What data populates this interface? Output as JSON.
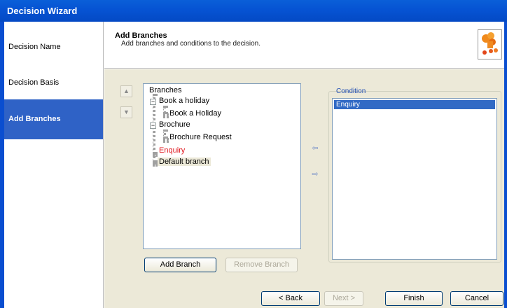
{
  "window": {
    "title": "Decision Wizard"
  },
  "sidebar": {
    "items": [
      {
        "label": "Decision Name"
      },
      {
        "label": "Decision Basis"
      },
      {
        "label": "Add Branches"
      }
    ]
  },
  "header": {
    "title": "Add Branches",
    "subtitle": "Add branches and conditions to the decision."
  },
  "tree": {
    "root": "Branches",
    "nodes": [
      {
        "label": "Book a holiday"
      },
      {
        "label": "Book a Holiday"
      },
      {
        "label": "Brochure"
      },
      {
        "label": "Brochure Request"
      },
      {
        "label": "Enquiry"
      },
      {
        "label": "Default branch"
      }
    ]
  },
  "condition": {
    "label": "Condition",
    "items": [
      "Enquiry"
    ]
  },
  "buttons": {
    "add_branch": "Add Branch",
    "remove_branch": "Remove Branch",
    "back": "< Back",
    "next": "Next >",
    "finish": "Finish",
    "cancel": "Cancel"
  },
  "colors": {
    "title_bar": "#0653d3",
    "sidebar_active": "#2f62c6",
    "selection": "#316ac5",
    "error_text": "#e0141b",
    "dialog_bg": "#ece9d8"
  },
  "icons": {
    "move_up": "arrow-up-icon",
    "move_down": "arrow-down-icon",
    "move_left": "arrow-left-icon",
    "move_right": "arrow-right-icon",
    "wizard": "wizard-branches-icon"
  }
}
